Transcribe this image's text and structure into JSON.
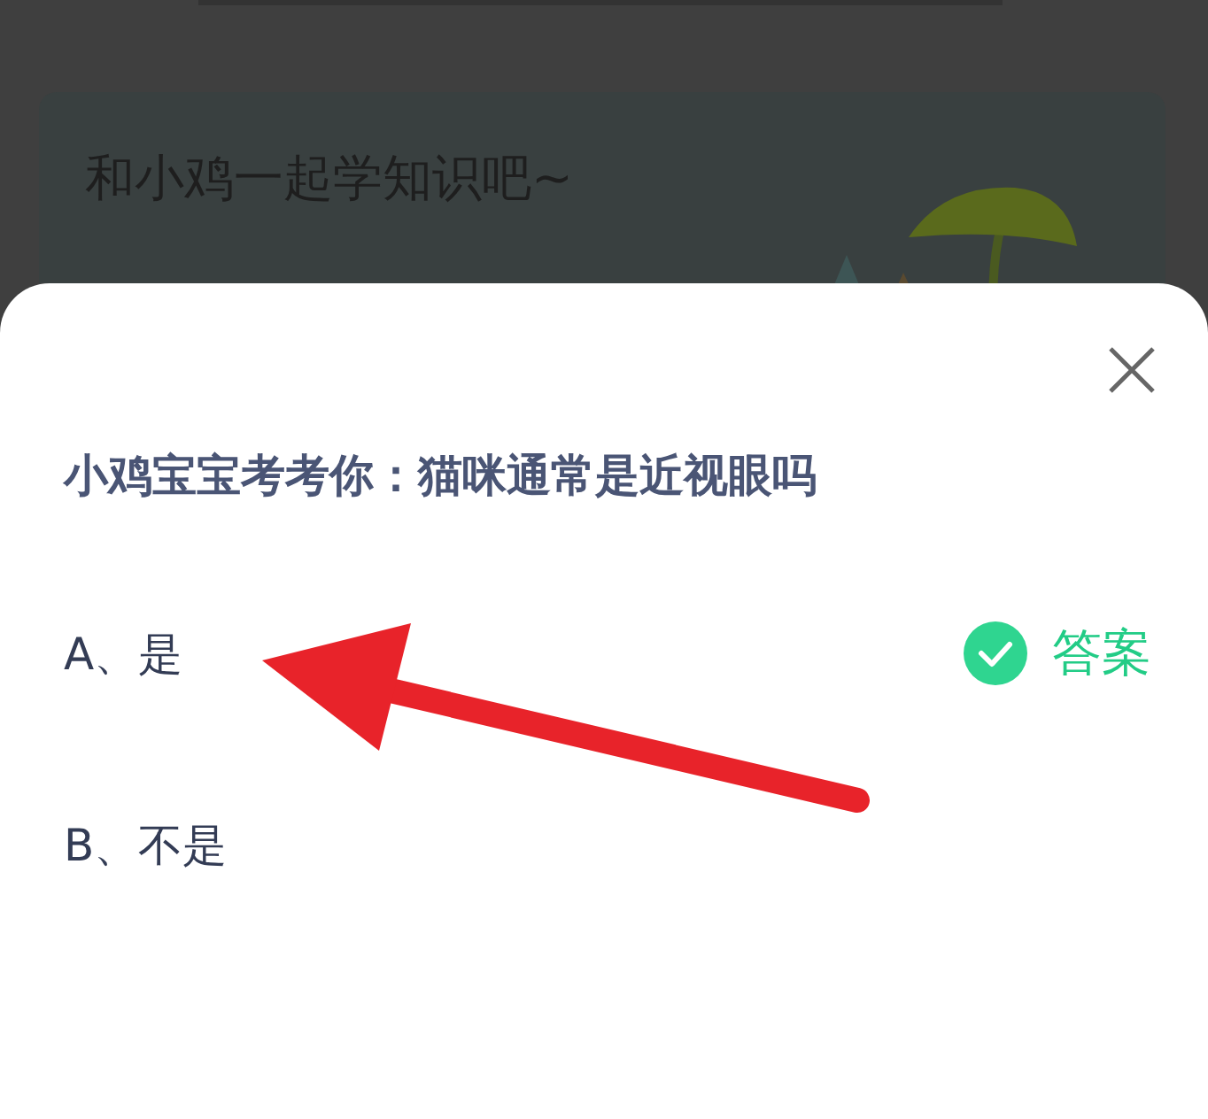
{
  "banner": {
    "title": "和小鸡一起学知识吧~"
  },
  "quiz": {
    "question": "小鸡宝宝考考你：猫咪通常是近视眼吗",
    "options": [
      {
        "label": "A、是",
        "correct": true,
        "answer_label": "答案"
      },
      {
        "label": "B、不是",
        "correct": false
      }
    ]
  }
}
